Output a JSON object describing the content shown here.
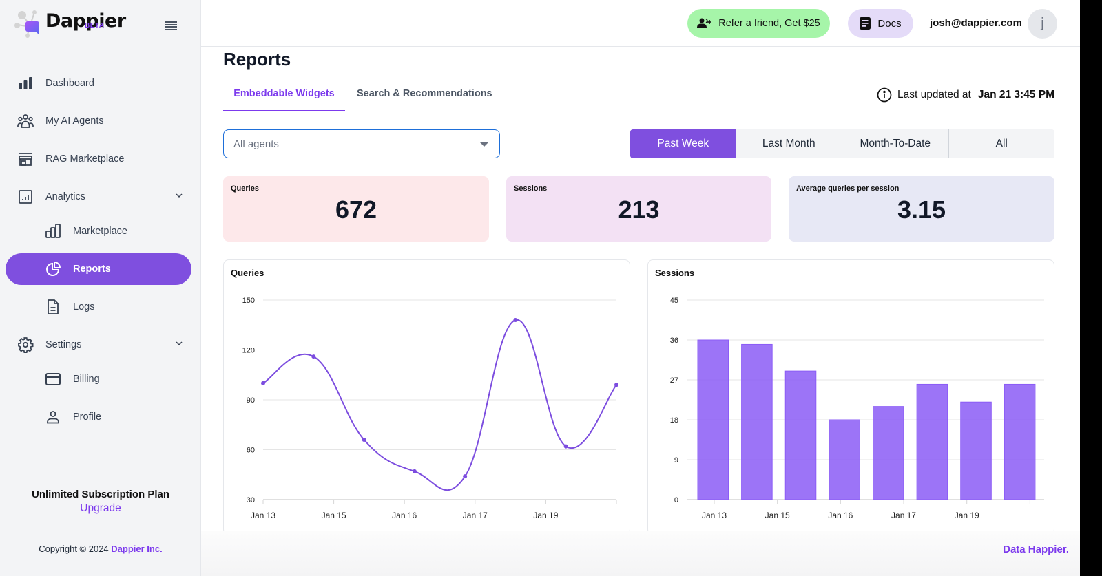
{
  "app": {
    "name": "Dappier",
    "badge": "BETA",
    "menu_icon": "hamburger-icon"
  },
  "header": {
    "refer_label": "Refer a friend, Get $25",
    "docs_label": "Docs",
    "user_email": "josh@dappier.com",
    "avatar_initial": "j"
  },
  "sidebar": {
    "items": [
      {
        "label": "Dashboard",
        "icon": "bar-chart-icon"
      },
      {
        "label": "My AI Agents",
        "icon": "users-icon"
      },
      {
        "label": "RAG Marketplace",
        "icon": "store-icon"
      },
      {
        "label": "Analytics",
        "icon": "analytics-icon",
        "expanded": true
      },
      {
        "label": "Marketplace",
        "icon": "chart-bars-icon"
      },
      {
        "label": "Reports",
        "icon": "pie-chart-icon",
        "active": true
      },
      {
        "label": "Logs",
        "icon": "document-icon"
      },
      {
        "label": "Settings",
        "icon": "gear-icon",
        "expanded": true
      },
      {
        "label": "Billing",
        "icon": "credit-card-icon"
      },
      {
        "label": "Profile",
        "icon": "user-icon"
      }
    ],
    "plan_title": "Unlimited Subscription Plan",
    "upgrade_label": "Upgrade",
    "copyright_prefix": "Copyright © 2024",
    "copyright_brand": "Dappier Inc."
  },
  "main": {
    "title": "Reports",
    "tabs": [
      {
        "label": "Embeddable Widgets",
        "active": true
      },
      {
        "label": "Search & Recommendations",
        "active": false
      }
    ],
    "last_updated_label": "Last updated at",
    "last_updated_value": "Jan 21 3:45 PM",
    "agent_select": {
      "placeholder": "All agents"
    },
    "ranges": [
      {
        "label": "Past Week",
        "active": true
      },
      {
        "label": "Last Month",
        "active": false
      },
      {
        "label": "Month-To-Date",
        "active": false
      },
      {
        "label": "All",
        "active": false
      }
    ],
    "stats": [
      {
        "label": "Queries",
        "value": "672",
        "color": "#fde8ea"
      },
      {
        "label": "Sessions",
        "value": "213",
        "color": "#f3e1f4"
      },
      {
        "label": "Average queries per session",
        "value": "3.15",
        "color": "#e7e8f5"
      }
    ]
  },
  "colors": {
    "accent": "#7f4fdf",
    "refer_bg": "#a6f5a9",
    "docs_bg": "#e4dbf8",
    "line": "#7c4ddf",
    "bar": "#8b5cf6"
  },
  "chart_data": [
    {
      "type": "line",
      "title": "Queries",
      "xlabel": "",
      "ylabel": "",
      "ylim": [
        30,
        150
      ],
      "yticks": [
        30,
        60,
        90,
        120,
        150
      ],
      "x_tick_labels": [
        "Jan 13",
        "Jan 15",
        "Jan 16",
        "Jan 17",
        "Jan 19"
      ],
      "points": 8,
      "values": [
        100,
        116,
        66,
        47,
        44,
        138,
        62,
        99
      ],
      "smooth": true,
      "grid": true,
      "legend": "none"
    },
    {
      "type": "bar",
      "title": "Sessions",
      "xlabel": "",
      "ylabel": "",
      "ylim": [
        0,
        45
      ],
      "yticks": [
        0,
        9,
        18,
        27,
        36,
        45
      ],
      "x_tick_labels": [
        "Jan 13",
        "Jan 15",
        "Jan 16",
        "Jan 17",
        "Jan 19"
      ],
      "values": [
        36,
        35,
        29,
        18,
        21,
        26,
        22,
        26
      ],
      "grid": true,
      "legend": "none"
    }
  ],
  "footer": {
    "tagline": "Data Happier."
  }
}
